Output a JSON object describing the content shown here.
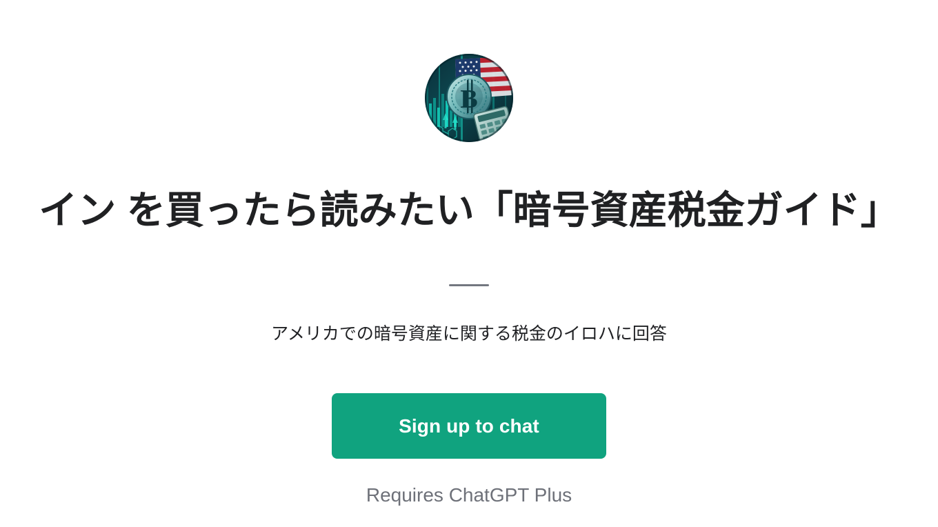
{
  "page": {
    "background_color": "#ffffff"
  },
  "avatar": {
    "icon": "crypto-tax-usa-avatar",
    "description": "Bitcoin coin over US flag with calculator and teal digital chart background",
    "colors": {
      "background_dark": "#0b2b33",
      "teal_glow": "#15d6c0",
      "flag_red": "#c8202e",
      "flag_blue": "#1f3a6e",
      "coin_silver": "#9fd8d8"
    }
  },
  "header": {
    "title": "イン を買ったら読みたい「暗号資産税金ガイド」",
    "title_color": "#202123",
    "divider_color": "#737780"
  },
  "main": {
    "subtitle": "アメリカでの暗号資産に関する税金のイロハに回答",
    "subtitle_color": "#1f2023"
  },
  "cta": {
    "label": "Sign up to chat",
    "background_color": "#10a37f",
    "text_color": "#ffffff"
  },
  "footer": {
    "requires_note": "Requires ChatGPT Plus",
    "note_color": "#6e7179"
  }
}
